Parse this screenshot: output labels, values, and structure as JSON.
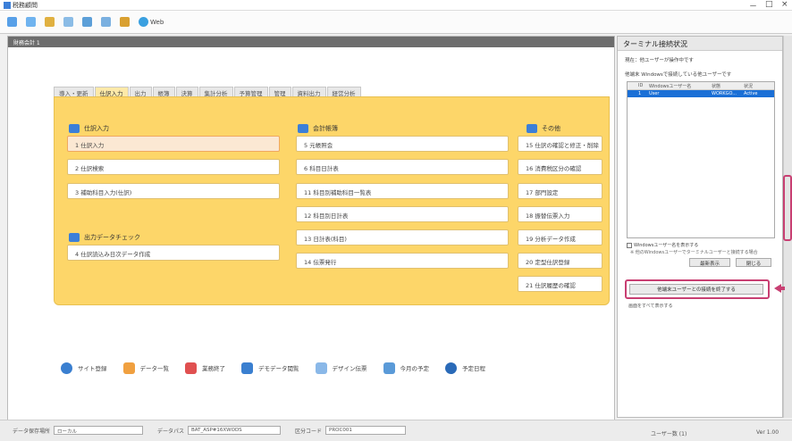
{
  "window": {
    "title": "税務顧問",
    "controls": [
      "－",
      "□",
      "×"
    ]
  },
  "toolbar": [
    {
      "icon": "home-icon",
      "label": ""
    },
    {
      "icon": "folder-icon",
      "label": ""
    },
    {
      "icon": "document-icon",
      "label": ""
    },
    {
      "icon": "refresh-icon",
      "label": ""
    },
    {
      "icon": "chart-icon",
      "label": ""
    },
    {
      "icon": "calendar-icon",
      "label": ""
    },
    {
      "icon": "settings-icon",
      "label": ""
    },
    {
      "icon": "help-icon",
      "label": "Web"
    }
  ],
  "left_panel": {
    "header": "財務会計 1"
  },
  "tabs": [
    "導入・更新",
    "仕訳入力",
    "出力",
    "帳簿",
    "決算",
    "集計分析",
    "予算管理",
    "管理",
    "資料出力",
    "経営分析"
  ],
  "active_tab_index": 1,
  "sections": {
    "col1_title": "仕訳入力",
    "col1_items": [
      "1 仕訳入力",
      "2 仕訳検索",
      "3 補助科目入力(仕訳)"
    ],
    "col1b_title": "出力データチェック",
    "col1b_items": [
      "4 仕訳読込み日次データ作成"
    ],
    "col2_title": "会計帳簿",
    "col2_items": [
      "5 元帳照会",
      "6 科目日計表",
      "11 科目別補助科目一覧表",
      "12 科目別日計表",
      "13 日計表(科目)",
      "14 伝票発行"
    ],
    "col3_title": "その他",
    "col3_items": [
      "15 仕訳の確認と修正・削除",
      "16 消費税区分の確認",
      "17 部門設定",
      "18 振替伝票入力",
      "19 分析データ作成",
      "20 定型仕訳登録",
      "21 仕訳履歴の確認"
    ]
  },
  "bottom_bar": [
    {
      "icon": "globe-icon",
      "label": "サイト登録"
    },
    {
      "icon": "list-icon",
      "label": "データ一覧"
    },
    {
      "icon": "close-square-icon",
      "label": "業務終了"
    },
    {
      "icon": "search-icon",
      "label": "デモデータ閲覧"
    },
    {
      "icon": "print-icon",
      "label": "デザイン伝票"
    },
    {
      "icon": "calendar-icon",
      "label": "今月の予定"
    },
    {
      "icon": "person-icon",
      "label": "予定日程"
    }
  ],
  "status_bar": {
    "field1_label": "データ保存場所",
    "field1_value": "ローカル",
    "field2_label": "データパス",
    "field2_value": "BAT_ASP#16XWODS",
    "field3_label": "区分コード",
    "field3_value": "PROC001",
    "right_text": "ユーザー数 (1)",
    "right_small": "Ver 1.00"
  },
  "right_panel": {
    "title": "ターミナル接続状況",
    "info1": "現在：他ユーザーが操作中です",
    "info2": "他端末 Windowsで接続している他ユーザーです",
    "grid_headers": [
      "",
      "ID",
      "Windowsユーザー名",
      "状態",
      "状況"
    ],
    "grid_rows": [
      [
        "",
        "1",
        "User",
        "WORKGO...",
        "Active"
      ]
    ],
    "checkbox_label": "Windowsユーザー名を表示する",
    "note": "※ 他のWindowsユーザーでターミナルユーザーと接続する場合",
    "btn_refresh": "最新表示",
    "btn_close": "閉じる",
    "group_label": "",
    "highlight_btn": "他端末ユーザーとの接続を終了する",
    "sublabel": "画面をすべて表示する"
  },
  "colors": {
    "accent_yellow": "#fdd669",
    "highlight": "#c83f72",
    "grid_sel": "#1a6fd6"
  }
}
